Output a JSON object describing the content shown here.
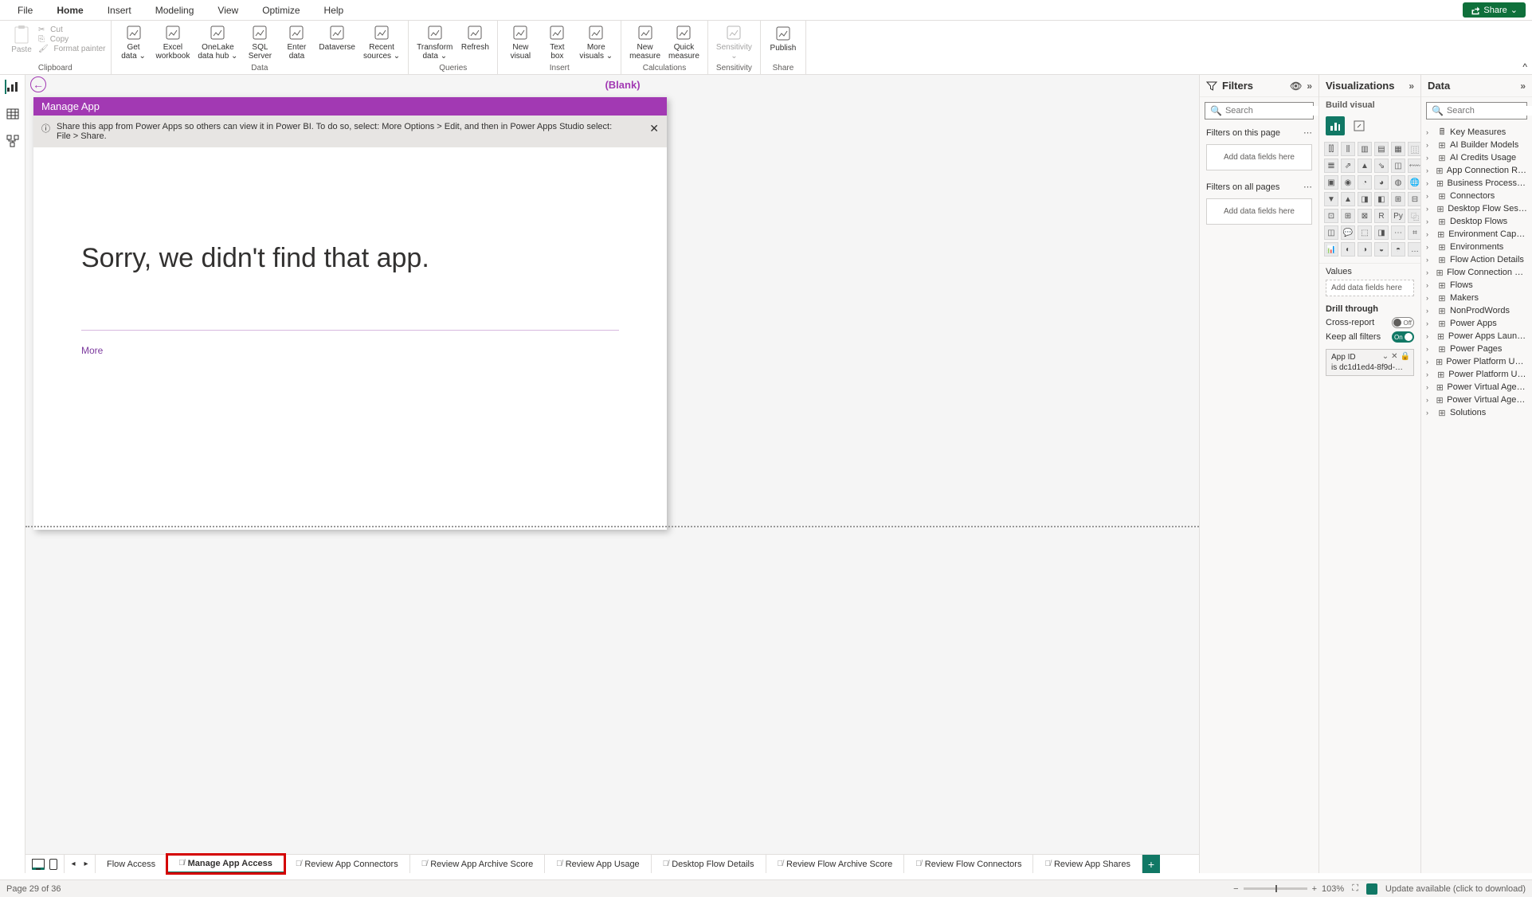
{
  "menubar": {
    "items": [
      "File",
      "Home",
      "Insert",
      "Modeling",
      "View",
      "Optimize",
      "Help"
    ],
    "active": 1,
    "share": "Share"
  },
  "ribbon": {
    "clipboard": {
      "paste": "Paste",
      "cut": "Cut",
      "copy": "Copy",
      "format": "Format painter",
      "label": "Clipboard"
    },
    "data": {
      "items": [
        {
          "l": "Get\ndata ⌄",
          "n": "get-data"
        },
        {
          "l": "Excel\nworkbook",
          "n": "excel-workbook"
        },
        {
          "l": "OneLake\ndata hub ⌄",
          "n": "onelake-hub"
        },
        {
          "l": "SQL\nServer",
          "n": "sql-server"
        },
        {
          "l": "Enter\ndata",
          "n": "enter-data"
        },
        {
          "l": "Dataverse",
          "n": "dataverse"
        },
        {
          "l": "Recent\nsources ⌄",
          "n": "recent-sources"
        }
      ],
      "label": "Data"
    },
    "queries": {
      "items": [
        {
          "l": "Transform\ndata ⌄",
          "n": "transform-data"
        },
        {
          "l": "Refresh",
          "n": "refresh"
        }
      ],
      "label": "Queries"
    },
    "insert": {
      "items": [
        {
          "l": "New\nvisual",
          "n": "new-visual"
        },
        {
          "l": "Text\nbox",
          "n": "text-box"
        },
        {
          "l": "More\nvisuals ⌄",
          "n": "more-visuals"
        }
      ],
      "label": "Insert"
    },
    "calc": {
      "items": [
        {
          "l": "New\nmeasure",
          "n": "new-measure"
        },
        {
          "l": "Quick\nmeasure",
          "n": "quick-measure"
        }
      ],
      "label": "Calculations"
    },
    "sens": {
      "items": [
        {
          "l": "Sensitivity\n⌄",
          "n": "sensitivity",
          "disabled": true
        }
      ],
      "label": "Sensitivity"
    },
    "share": {
      "items": [
        {
          "l": "Publish",
          "n": "publish"
        }
      ],
      "label": "Share"
    }
  },
  "canvas": {
    "title": "(Blank)",
    "appheader": "Manage App",
    "info": "Share this app from Power Apps so others can view it in Power BI. To do so, select: More Options > Edit, and then in Power Apps Studio select: File > Share.",
    "msg": "Sorry, we didn't find that app.",
    "more": "More"
  },
  "tabs": {
    "cut": "Flow Access",
    "items": [
      {
        "l": "Manage App Access",
        "active": true,
        "hl": true
      },
      {
        "l": "Review App Connectors"
      },
      {
        "l": "Review App Archive Score"
      },
      {
        "l": "Review App Usage"
      },
      {
        "l": "Desktop Flow Details"
      },
      {
        "l": "Review Flow Archive Score"
      },
      {
        "l": "Review Flow Connectors"
      },
      {
        "l": "Review App Shares"
      }
    ]
  },
  "filters": {
    "title": "Filters",
    "search_ph": "Search",
    "sec1": "Filters on this page",
    "drop": "Add data fields here",
    "sec2": "Filters on all pages"
  },
  "viz": {
    "title": "Visualizations",
    "sub": "Build visual",
    "values": "Values",
    "valdrop": "Add data fields here",
    "drill": "Drill through",
    "cross": "Cross-report",
    "cross_state": "Off",
    "keep": "Keep all filters",
    "keep_state": "On",
    "card_title": "App ID",
    "card_sub": "is dc1d1ed4-8f9d-…"
  },
  "data": {
    "title": "Data",
    "search_ph": "Search",
    "tables": [
      "Key Measures",
      "AI Builder Models",
      "AI Credits Usage",
      "App Connection Refere…",
      "Business Process Flows",
      "Connectors",
      "Desktop Flow Sessions",
      "Desktop Flows",
      "Environment Capacity",
      "Environments",
      "Flow Action Details",
      "Flow Connection Refer…",
      "Flows",
      "Makers",
      "NonProdWords",
      "Power Apps",
      "Power Apps Launches",
      "Power Pages",
      "Power Platform User Ro…",
      "Power Platform Users",
      "Power Virtual Agent bots",
      "Power Virtual Agent bo…",
      "Solutions"
    ]
  },
  "status": {
    "page": "Page 29 of 36",
    "zoom": "103%",
    "update": "Update available (click to download)"
  }
}
